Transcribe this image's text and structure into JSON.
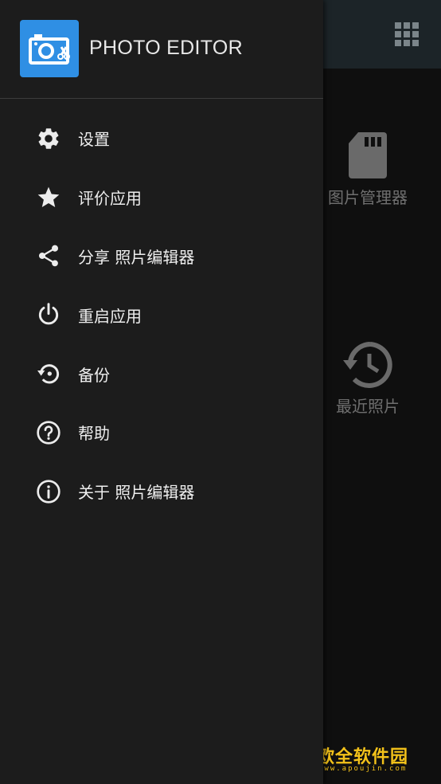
{
  "app": {
    "title": "PHOTO EDITOR"
  },
  "background": {
    "toolbar_icon": "grid-icon",
    "tiles": [
      {
        "label": "图片管理器",
        "icon": "sd-card-icon"
      },
      {
        "label": "最近照片",
        "icon": "history-icon"
      }
    ]
  },
  "drawer": {
    "menu": [
      {
        "label": "设置",
        "icon": "gear-icon"
      },
      {
        "label": "评价应用",
        "icon": "star-icon"
      },
      {
        "label": "分享 照片编辑器",
        "icon": "share-icon"
      },
      {
        "label": "重启应用",
        "icon": "power-icon"
      },
      {
        "label": "备份",
        "icon": "backup-restore-icon"
      },
      {
        "label": "帮助",
        "icon": "help-icon"
      },
      {
        "label": "关于 照片编辑器",
        "icon": "info-icon"
      }
    ]
  },
  "watermark": {
    "text": "欧全软件园",
    "url": "www.apoujin.com"
  },
  "colors": {
    "drawer_bg": "#1c1c1c",
    "toolbar_bg": "#1c2428",
    "accent": "#2f8fe4",
    "text": "#eeeeee",
    "muted": "#6f6f6f",
    "watermark": "#f3c21a"
  }
}
